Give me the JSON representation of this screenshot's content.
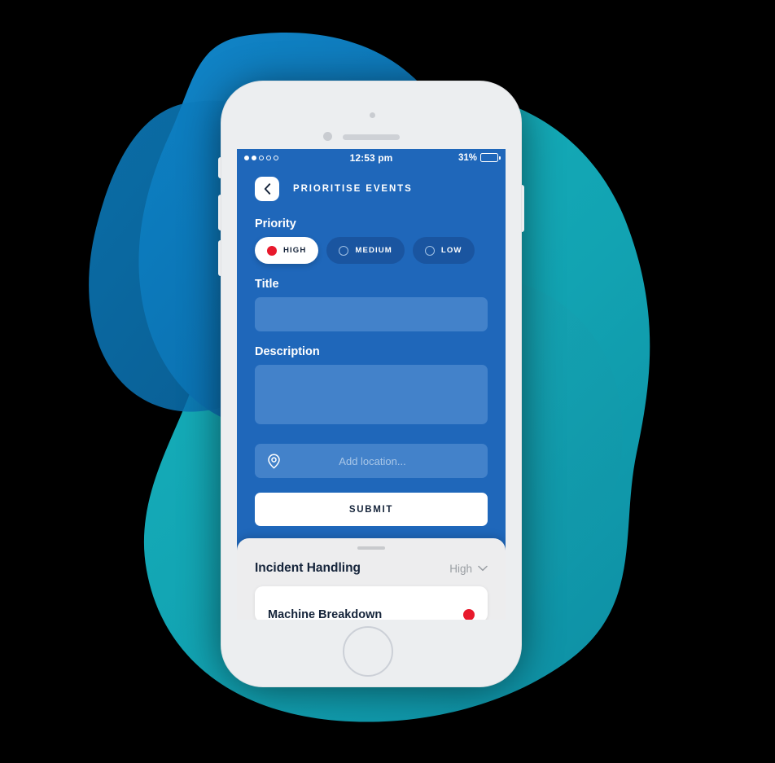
{
  "theme": {
    "background": "#000000",
    "screen_blue": "#1f67ba",
    "field_blue": "#4382ca",
    "pill_blue": "#1a55a0",
    "accent_red": "#e8192c",
    "blob_blue": "#0c7ac0",
    "blob_teal": "#16a7b5",
    "phone_body": "#eceef0",
    "sheet_grey": "#ededee",
    "dark_text": "#15243a"
  },
  "status_bar": {
    "signal_dots_total": 5,
    "signal_dots_filled": 2,
    "time": "12:53 pm",
    "battery_percent": "31%",
    "battery_level": 31
  },
  "nav": {
    "back_icon": "chevron-left-icon",
    "title": "PRIORITISE EVENTS"
  },
  "form": {
    "priority": {
      "label": "Priority",
      "options": [
        {
          "label": "HIGH",
          "selected": true,
          "dot": "filled-red-dot"
        },
        {
          "label": "MEDIUM",
          "selected": false,
          "dot": "hollow-circle"
        },
        {
          "label": "LOW",
          "selected": false,
          "dot": "hollow-circle"
        }
      ]
    },
    "title": {
      "label": "Title",
      "value": "",
      "placeholder": ""
    },
    "description": {
      "label": "Description",
      "value": "",
      "placeholder": ""
    },
    "location": {
      "icon": "map-pin-icon",
      "value": "",
      "placeholder": "Add location..."
    },
    "submit_label": "SUBMIT"
  },
  "bottom_sheet": {
    "handle": "drag-handle",
    "title": "Incident Handling",
    "filter_value": "High",
    "filter_icon": "chevron-down-icon",
    "cards": [
      {
        "title": "Machine Breakdown",
        "status_dot": "red"
      }
    ]
  }
}
